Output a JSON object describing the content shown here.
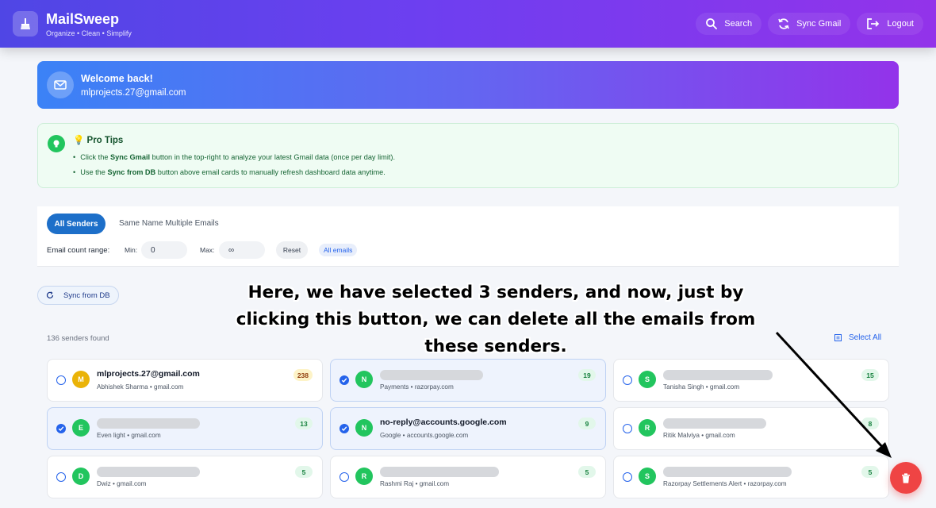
{
  "header": {
    "brand": "MailSweep",
    "tagline": "Organize • Clean • Simplify",
    "search_label": "Search",
    "sync_label": "Sync Gmail",
    "logout_label": "Logout"
  },
  "welcome": {
    "title": "Welcome back!",
    "email": "mlprojects.27@gmail.com"
  },
  "tips": {
    "title": "Pro Tips",
    "tip1_pre": "Click the ",
    "tip1_bold": "Sync Gmail",
    "tip1_post": " button in the top-right to analyze your latest Gmail data (once per day limit).",
    "tip2_pre": "Use the ",
    "tip2_bold": "Sync from DB",
    "tip2_post": " button above email cards to manually refresh dashboard data anytime."
  },
  "filters": {
    "tab_all": "All Senders",
    "tab_same": "Same Name Multiple Emails",
    "range_label": "Email count range:",
    "min_label": "Min:",
    "min_value": "0",
    "max_label": "Max:",
    "max_value": "∞",
    "reset_label": "Reset",
    "chip": "All emails"
  },
  "sync_db_label": "Sync from DB",
  "annotation": "Here, we have selected 3 senders, and now, just by clicking this button, we can delete all the emails from these senders.",
  "senders_found": "136 senders found",
  "select_all": "Select All",
  "cards": [
    {
      "initial": "M",
      "color": "#eab308",
      "name": "mlprojects.27@gmail.com",
      "meta": "Abhishek Sharma • gmail.com",
      "count": "238",
      "checked": false,
      "redacted": false,
      "badge": "yellow"
    },
    {
      "initial": "N",
      "color": "#22c55e",
      "name": "",
      "meta": "Payments • razorpay.com",
      "count": "19",
      "checked": true,
      "redacted": true,
      "badge": "green"
    },
    {
      "initial": "S",
      "color": "#22c55e",
      "name": "",
      "meta": "Tanisha Singh • gmail.com",
      "count": "15",
      "checked": false,
      "redacted": true,
      "badge": "green"
    },
    {
      "initial": "E",
      "color": "#22c55e",
      "name": "",
      "meta": "Even light • gmail.com",
      "count": "13",
      "checked": true,
      "redacted": true,
      "badge": "green"
    },
    {
      "initial": "N",
      "color": "#22c55e",
      "name": "no-reply@accounts.google.com",
      "meta": "Google • accounts.google.com",
      "count": "9",
      "checked": true,
      "redacted": false,
      "badge": "green"
    },
    {
      "initial": "R",
      "color": "#22c55e",
      "name": "",
      "meta": "Ritik Malviya • gmail.com",
      "count": "8",
      "checked": false,
      "redacted": true,
      "badge": "green"
    },
    {
      "initial": "D",
      "color": "#22c55e",
      "name": "",
      "meta": "Dwiz • gmail.com",
      "count": "5",
      "checked": false,
      "redacted": true,
      "badge": "green"
    },
    {
      "initial": "R",
      "color": "#22c55e",
      "name": "",
      "meta": "Rashmi Raj • gmail.com",
      "count": "5",
      "checked": false,
      "redacted": true,
      "badge": "green"
    },
    {
      "initial": "S",
      "color": "#22c55e",
      "name": "",
      "meta": "Razorpay Settlements Alert • razorpay.com",
      "count": "5",
      "checked": false,
      "redacted": true,
      "badge": "green"
    }
  ],
  "icons": {
    "logo": "broom-icon",
    "search": "search-icon",
    "sync": "sync-icon",
    "logout": "logout-icon",
    "mail": "mail-icon",
    "tip": "lightbulb-icon",
    "delete": "trash-icon"
  },
  "colors": {
    "accent": "#2563eb",
    "danger": "#ef4444",
    "success": "#22c55e"
  }
}
